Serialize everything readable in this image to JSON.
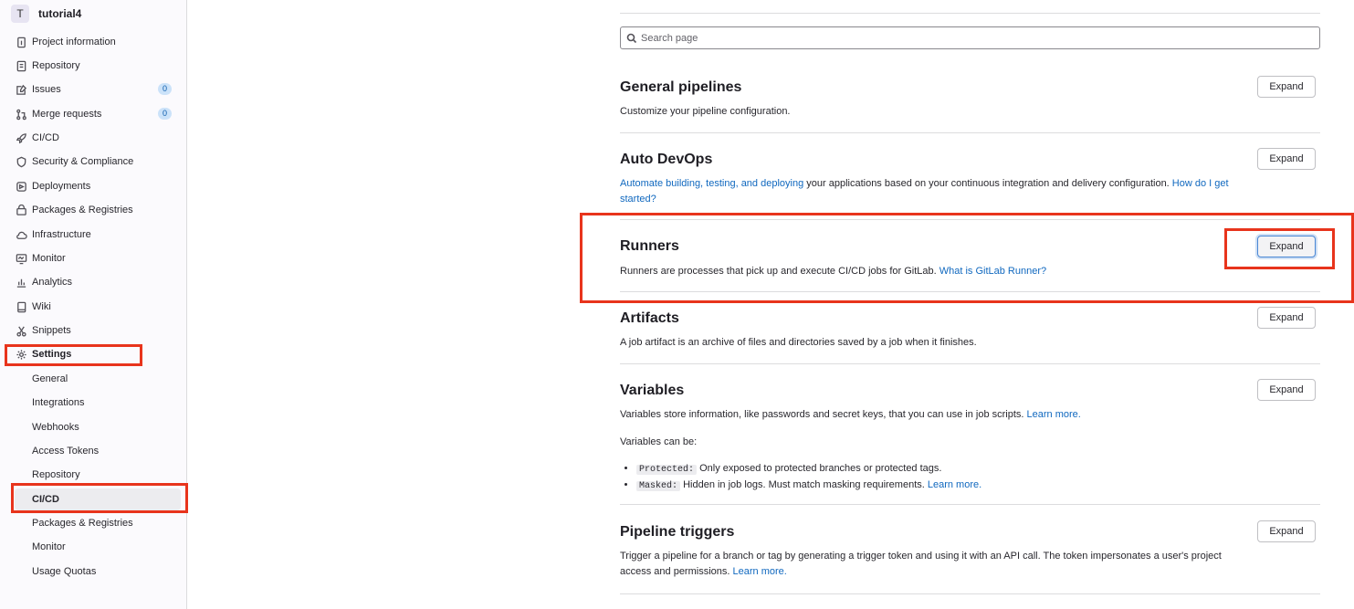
{
  "project": {
    "avatar_letter": "T",
    "name": "tutorial4"
  },
  "sidebar": {
    "items": [
      {
        "label": "Project information",
        "icon": "info-icon"
      },
      {
        "label": "Repository",
        "icon": "document-icon"
      },
      {
        "label": "Issues",
        "icon": "issues-icon",
        "badge": "0"
      },
      {
        "label": "Merge requests",
        "icon": "merge-request-icon",
        "badge": "0"
      },
      {
        "label": "CI/CD",
        "icon": "rocket-icon"
      },
      {
        "label": "Security & Compliance",
        "icon": "shield-icon"
      },
      {
        "label": "Deployments",
        "icon": "deployments-icon"
      },
      {
        "label": "Packages & Registries",
        "icon": "package-icon"
      },
      {
        "label": "Infrastructure",
        "icon": "cloud-icon"
      },
      {
        "label": "Monitor",
        "icon": "monitor-icon"
      },
      {
        "label": "Analytics",
        "icon": "chart-icon"
      },
      {
        "label": "Wiki",
        "icon": "book-icon"
      },
      {
        "label": "Snippets",
        "icon": "scissors-icon"
      },
      {
        "label": "Settings",
        "icon": "gear-icon"
      }
    ],
    "settings_sub": [
      "General",
      "Integrations",
      "Webhooks",
      "Access Tokens",
      "Repository",
      "CI/CD",
      "Packages & Registries",
      "Monitor",
      "Usage Quotas"
    ]
  },
  "search": {
    "placeholder": "Search page"
  },
  "sections": {
    "expand_label": "Expand",
    "general": {
      "title": "General pipelines",
      "desc": "Customize your pipeline configuration."
    },
    "autodevops": {
      "title": "Auto DevOps",
      "link1": "Automate building, testing, and deploying",
      "text": " your applications based on your continuous integration and delivery configuration. ",
      "link2": "How do I get started?"
    },
    "runners": {
      "title": "Runners",
      "text": "Runners are processes that pick up and execute CI/CD jobs for GitLab. ",
      "link": "What is GitLab Runner?"
    },
    "artifacts": {
      "title": "Artifacts",
      "desc": "A job artifact is an archive of files and directories saved by a job when it finishes."
    },
    "variables": {
      "title": "Variables",
      "text": "Variables store information, like passwords and secret keys, that you can use in job scripts. ",
      "link": "Learn more.",
      "can_be": "Variables can be:",
      "protected_code": "Protected:",
      "protected_text": " Only exposed to protected branches or protected tags.",
      "masked_code": "Masked:",
      "masked_text": " Hidden in job logs. Must match masking requirements. ",
      "masked_link": "Learn more."
    },
    "triggers": {
      "title": "Pipeline triggers",
      "text": "Trigger a pipeline for a branch or tag by generating a trigger token and using it with an API call. The token impersonates a user's project access and permissions. ",
      "link": "Learn more."
    }
  }
}
